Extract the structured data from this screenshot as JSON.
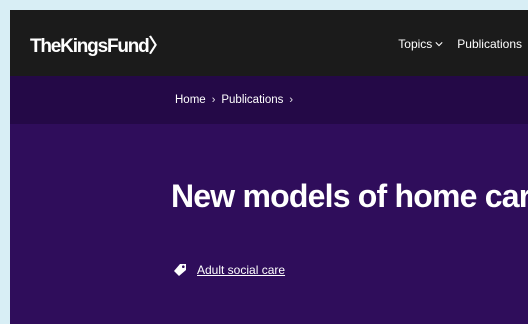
{
  "header": {
    "logo_text": "TheKingsFund",
    "logo_mark": "〉",
    "nav": [
      {
        "label": "Topics"
      },
      {
        "label": "Publications"
      }
    ]
  },
  "breadcrumb": {
    "items": [
      {
        "label": "Home"
      },
      {
        "label": "Publications"
      }
    ],
    "separator": "›"
  },
  "page": {
    "title": "New models of home care",
    "tag_label": "Adult social care"
  },
  "colors": {
    "header_bg": "#1b1b1b",
    "crumb_bg": "#240947",
    "hero_bg": "#2f0d5b",
    "page_bg": "#d8eef5",
    "text": "#ffffff"
  },
  "icons": {
    "topics_chevron": "chevron-down-icon",
    "tag": "tag-icon"
  }
}
